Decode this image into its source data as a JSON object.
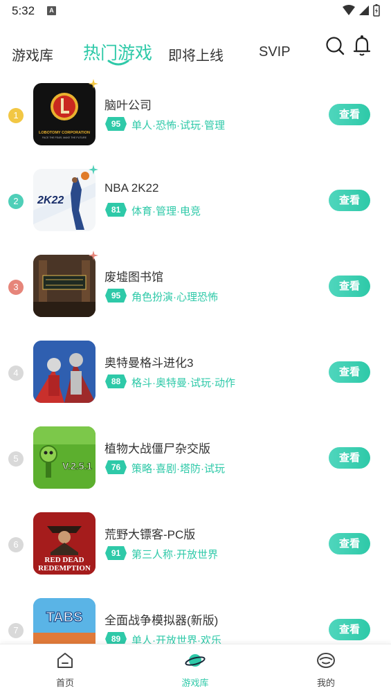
{
  "status": {
    "time": "5:32",
    "badge": "A"
  },
  "tabs": [
    {
      "label": "游戏库"
    },
    {
      "label": "热门游戏"
    },
    {
      "label": "即将上线"
    },
    {
      "label": "SVIP"
    }
  ],
  "colors": {
    "accent": "#2ec9a8",
    "rank_gold": "#f2c744",
    "rank_teal": "#4fcfb8",
    "rank_red": "#e6857a",
    "rank_grey": "#d9d9d9"
  },
  "games": [
    {
      "rank": "1",
      "name": "脑叶公司",
      "score": "95",
      "tags": "单人·恐怖·试玩·管理",
      "button": "查看",
      "cover_text": "LOBOTOMY CORPORATION",
      "cover_sub": "FACE THE FEAR, MAKE THE FUTURE"
    },
    {
      "rank": "2",
      "name": "NBA 2K22",
      "score": "81",
      "tags": "体育·管理·电竞",
      "button": "查看",
      "cover_text": "2K22"
    },
    {
      "rank": "3",
      "name": "废墟图书馆",
      "score": "95",
      "tags": "角色扮演·心理恐怖",
      "button": "查看"
    },
    {
      "rank": "4",
      "name": "奥特曼格斗进化3",
      "score": "88",
      "tags": "格斗·奥特曼·试玩·动作",
      "button": "查看"
    },
    {
      "rank": "5",
      "name": "植物大战僵尸杂交版",
      "score": "76",
      "tags": "策略·喜剧·塔防·试玩",
      "button": "查看",
      "cover_text": "V.2.5.1"
    },
    {
      "rank": "6",
      "name": "荒野大镖客-PC版",
      "score": "91",
      "tags": "第三人称·开放世界",
      "button": "查看",
      "cover_text": "RED DEAD",
      "cover_sub": "REDEMPTION"
    },
    {
      "rank": "7",
      "name": "全面战争模拟器(新版)",
      "score": "89",
      "tags": "单人·开放世界·欢乐",
      "button": "查看",
      "cover_text": "TABS"
    }
  ],
  "bottom_nav": [
    {
      "label": "首页",
      "icon": "home-icon"
    },
    {
      "label": "游戏库",
      "icon": "planet-icon"
    },
    {
      "label": "我的",
      "icon": "profile-icon"
    }
  ]
}
